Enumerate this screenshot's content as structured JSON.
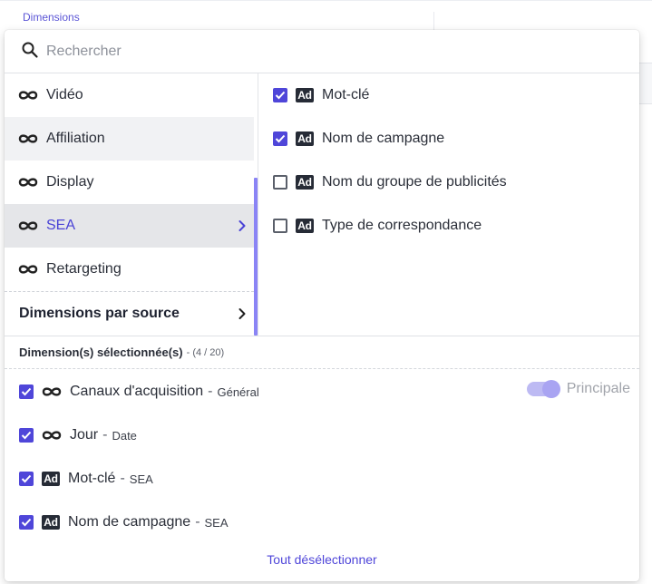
{
  "background": {
    "tab_label": "Dimensions"
  },
  "search": {
    "icon": "search-icon",
    "placeholder": "Rechercher",
    "value": ""
  },
  "sources": {
    "items": [
      {
        "label": "Vidéo",
        "icon": "infinity-icon",
        "state": "normal"
      },
      {
        "label": "Affiliation",
        "icon": "infinity-icon",
        "state": "hovered"
      },
      {
        "label": "Display",
        "icon": "infinity-icon",
        "state": "normal"
      },
      {
        "label": "SEA",
        "icon": "infinity-icon",
        "state": "active"
      },
      {
        "label": "Retargeting",
        "icon": "infinity-icon",
        "state": "normal"
      }
    ],
    "by_source_label": "Dimensions par source"
  },
  "dimensions": {
    "items": [
      {
        "label": "Mot-clé",
        "badge": "Ad",
        "checked": true
      },
      {
        "label": "Nom de campagne",
        "badge": "Ad",
        "checked": true
      },
      {
        "label": "Nom du groupe de publicités",
        "badge": "Ad",
        "checked": false
      },
      {
        "label": "Type de correspondance",
        "badge": "Ad",
        "checked": false
      }
    ]
  },
  "selected": {
    "title": "Dimension(s) sélectionnée(s)",
    "count": "- (4 / 20)",
    "separator": "-",
    "items": [
      {
        "label": "Canaux d'acquisition",
        "category": "Général",
        "icon": "infinity-icon",
        "checked": true
      },
      {
        "label": "Jour",
        "category": "Date",
        "icon": "infinity-icon",
        "checked": true
      },
      {
        "label": "Mot-clé",
        "category": "SEA",
        "badge": "Ad",
        "checked": true
      },
      {
        "label": "Nom de campagne",
        "category": "SEA",
        "badge": "Ad",
        "checked": true
      }
    ],
    "principal_label": "Principale",
    "principal_on": true
  },
  "deselect_all_label": "Tout désélectionner",
  "colors": {
    "accent": "#4f46d9",
    "active_text": "#4a43d6",
    "scroll_thumb": "#8a84f5",
    "badge_bg": "#262b36"
  }
}
